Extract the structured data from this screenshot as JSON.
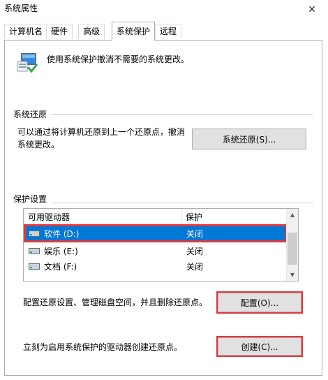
{
  "window": {
    "title": "系统属性",
    "close_glyph": "✕"
  },
  "tabs": [
    {
      "label": "计算机名",
      "active": false
    },
    {
      "label": "硬件",
      "active": false
    },
    {
      "label": "高级",
      "active": false
    },
    {
      "label": "系统保护",
      "active": true
    },
    {
      "label": "远程",
      "active": false
    }
  ],
  "header": {
    "icon": "system-protection-icon",
    "text": "使用系统保护撤消不需要的系统更改。"
  },
  "restore": {
    "group_label": "系统还原",
    "description": "可以通过将计算机还原到上一个还原点，撤消系统更改。",
    "button_label": "系统还原(S)..."
  },
  "protection": {
    "group_label": "保护设置",
    "columns": [
      "可用驱动器",
      "保护"
    ],
    "drives": [
      {
        "name": "软件 (D:)",
        "protection": "关闭",
        "selected": true
      },
      {
        "name": "娱乐 (E:)",
        "protection": "关闭",
        "selected": false
      },
      {
        "name": "文档 (F:)",
        "protection": "关闭",
        "selected": false
      }
    ],
    "config_text": "配置还原设置、管理磁盘空间，并且删除还原点。",
    "config_button": "配置(O)...",
    "create_text": "立刻为启用系统保护的驱动器创建还原点。",
    "create_button": "创建(C)..."
  },
  "colors": {
    "selection": "#0078d7",
    "highlight_box": "#e0383e"
  }
}
